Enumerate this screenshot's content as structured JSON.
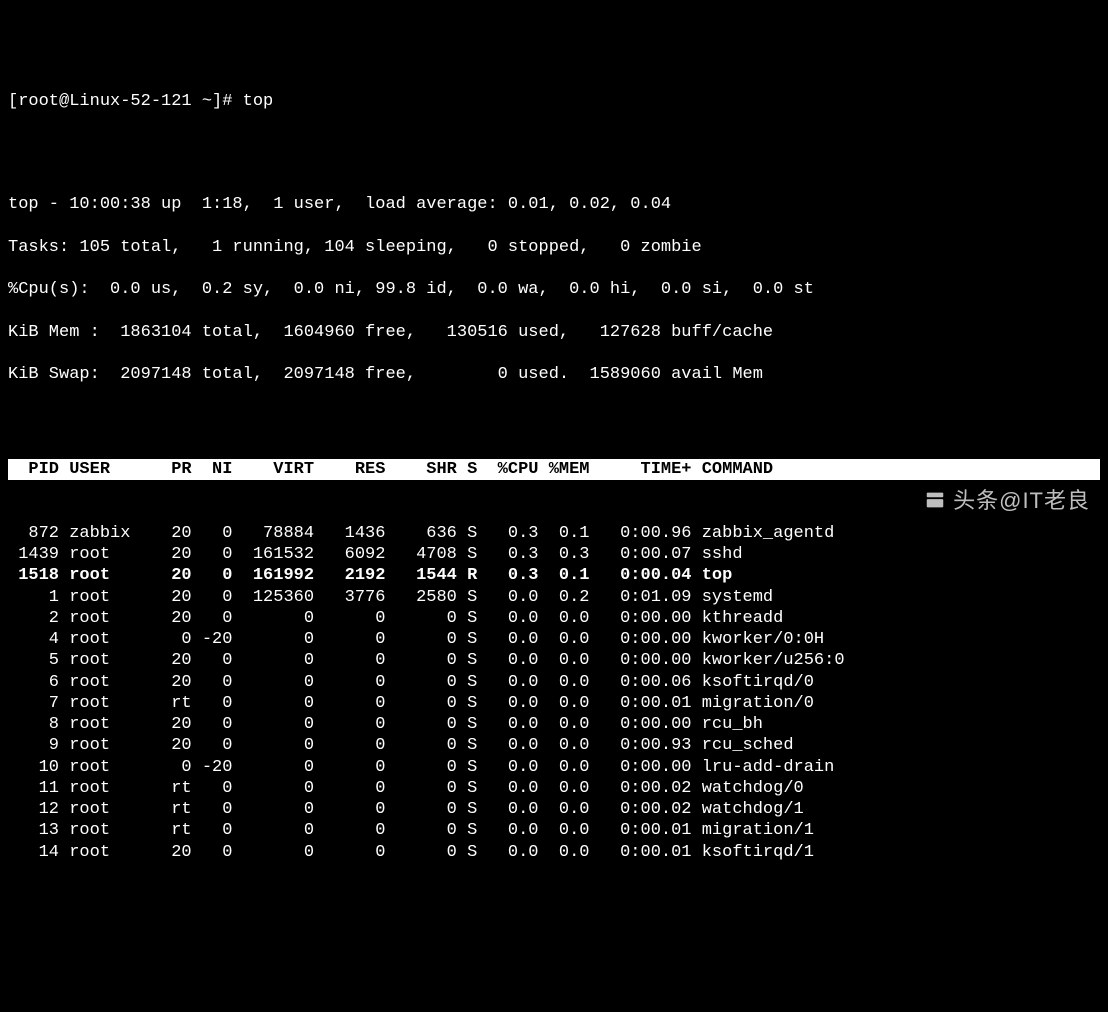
{
  "prompt": "[root@Linux-52-121 ~]# top",
  "summary": {
    "line1": "top - 10:00:38 up  1:18,  1 user,  load average: 0.01, 0.02, 0.04",
    "line2": "Tasks: 105 total,   1 running, 104 sleeping,   0 stopped,   0 zombie",
    "line3": "%Cpu(s):  0.0 us,  0.2 sy,  0.0 ni, 99.8 id,  0.0 wa,  0.0 hi,  0.0 si,  0.0 st",
    "line4": "KiB Mem :  1863104 total,  1604960 free,   130516 used,   127628 buff/cache",
    "line5": "KiB Swap:  2097148 total,  2097148 free,        0 used.  1589060 avail Mem"
  },
  "columns": [
    "PID",
    "USER",
    "PR",
    "NI",
    "VIRT",
    "RES",
    "SHR",
    "S",
    "%CPU",
    "%MEM",
    "TIME+",
    "COMMAND"
  ],
  "header_text": "  PID USER      PR  NI    VIRT    RES    SHR S  %CPU %MEM     TIME+ COMMAND                  ",
  "rows": [
    {
      "pid": 872,
      "user": "zabbix",
      "pr": "20",
      "ni": "0",
      "virt": "78884",
      "res": "1436",
      "shr": "636",
      "s": "S",
      "cpu": "0.3",
      "mem": "0.1",
      "time": "0:00.96",
      "cmd": "zabbix_agentd",
      "bold": false
    },
    {
      "pid": 1439,
      "user": "root",
      "pr": "20",
      "ni": "0",
      "virt": "161532",
      "res": "6092",
      "shr": "4708",
      "s": "S",
      "cpu": "0.3",
      "mem": "0.3",
      "time": "0:00.07",
      "cmd": "sshd",
      "bold": false
    },
    {
      "pid": 1518,
      "user": "root",
      "pr": "20",
      "ni": "0",
      "virt": "161992",
      "res": "2192",
      "shr": "1544",
      "s": "R",
      "cpu": "0.3",
      "mem": "0.1",
      "time": "0:00.04",
      "cmd": "top",
      "bold": true
    },
    {
      "pid": 1,
      "user": "root",
      "pr": "20",
      "ni": "0",
      "virt": "125360",
      "res": "3776",
      "shr": "2580",
      "s": "S",
      "cpu": "0.0",
      "mem": "0.2",
      "time": "0:01.09",
      "cmd": "systemd",
      "bold": false
    },
    {
      "pid": 2,
      "user": "root",
      "pr": "20",
      "ni": "0",
      "virt": "0",
      "res": "0",
      "shr": "0",
      "s": "S",
      "cpu": "0.0",
      "mem": "0.0",
      "time": "0:00.00",
      "cmd": "kthreadd",
      "bold": false
    },
    {
      "pid": 4,
      "user": "root",
      "pr": "0",
      "ni": "-20",
      "virt": "0",
      "res": "0",
      "shr": "0",
      "s": "S",
      "cpu": "0.0",
      "mem": "0.0",
      "time": "0:00.00",
      "cmd": "kworker/0:0H",
      "bold": false
    },
    {
      "pid": 5,
      "user": "root",
      "pr": "20",
      "ni": "0",
      "virt": "0",
      "res": "0",
      "shr": "0",
      "s": "S",
      "cpu": "0.0",
      "mem": "0.0",
      "time": "0:00.00",
      "cmd": "kworker/u256:0",
      "bold": false
    },
    {
      "pid": 6,
      "user": "root",
      "pr": "20",
      "ni": "0",
      "virt": "0",
      "res": "0",
      "shr": "0",
      "s": "S",
      "cpu": "0.0",
      "mem": "0.0",
      "time": "0:00.06",
      "cmd": "ksoftirqd/0",
      "bold": false
    },
    {
      "pid": 7,
      "user": "root",
      "pr": "rt",
      "ni": "0",
      "virt": "0",
      "res": "0",
      "shr": "0",
      "s": "S",
      "cpu": "0.0",
      "mem": "0.0",
      "time": "0:00.01",
      "cmd": "migration/0",
      "bold": false
    },
    {
      "pid": 8,
      "user": "root",
      "pr": "20",
      "ni": "0",
      "virt": "0",
      "res": "0",
      "shr": "0",
      "s": "S",
      "cpu": "0.0",
      "mem": "0.0",
      "time": "0:00.00",
      "cmd": "rcu_bh",
      "bold": false
    },
    {
      "pid": 9,
      "user": "root",
      "pr": "20",
      "ni": "0",
      "virt": "0",
      "res": "0",
      "shr": "0",
      "s": "S",
      "cpu": "0.0",
      "mem": "0.0",
      "time": "0:00.93",
      "cmd": "rcu_sched",
      "bold": false
    },
    {
      "pid": 10,
      "user": "root",
      "pr": "0",
      "ni": "-20",
      "virt": "0",
      "res": "0",
      "shr": "0",
      "s": "S",
      "cpu": "0.0",
      "mem": "0.0",
      "time": "0:00.00",
      "cmd": "lru-add-drain",
      "bold": false
    },
    {
      "pid": 11,
      "user": "root",
      "pr": "rt",
      "ni": "0",
      "virt": "0",
      "res": "0",
      "shr": "0",
      "s": "S",
      "cpu": "0.0",
      "mem": "0.0",
      "time": "0:00.02",
      "cmd": "watchdog/0",
      "bold": false
    },
    {
      "pid": 12,
      "user": "root",
      "pr": "rt",
      "ni": "0",
      "virt": "0",
      "res": "0",
      "shr": "0",
      "s": "S",
      "cpu": "0.0",
      "mem": "0.0",
      "time": "0:00.02",
      "cmd": "watchdog/1",
      "bold": false
    },
    {
      "pid": 13,
      "user": "root",
      "pr": "rt",
      "ni": "0",
      "virt": "0",
      "res": "0",
      "shr": "0",
      "s": "S",
      "cpu": "0.0",
      "mem": "0.0",
      "time": "0:00.01",
      "cmd": "migration/1",
      "bold": false
    },
    {
      "pid": 14,
      "user": "root",
      "pr": "20",
      "ni": "0",
      "virt": "0",
      "res": "0",
      "shr": "0",
      "s": "S",
      "cpu": "0.0",
      "mem": "0.0",
      "time": "0:00.01",
      "cmd": "ksoftirqd/1",
      "bold": false
    }
  ],
  "watermark": "头条@IT老良"
}
